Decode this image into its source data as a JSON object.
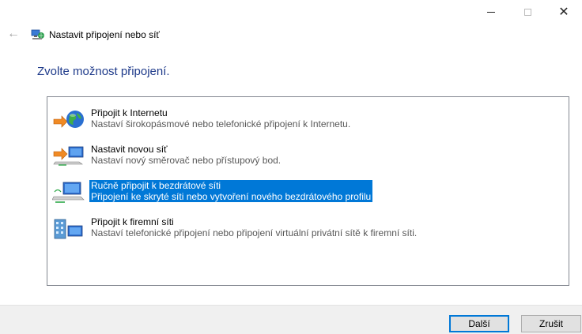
{
  "window": {
    "minimize_icon": "minimize-icon",
    "maximize_icon": "maximize-icon",
    "close_glyph": "✕"
  },
  "nav": {
    "back_glyph": "←",
    "title": "Nastavit připojení nebo síť"
  },
  "heading": "Zvolte možnost připojení.",
  "options": [
    {
      "title": "Připojit k Internetu",
      "description": "Nastaví širokopásmové nebo telefonické připojení k Internetu.",
      "icon": "globe-connection-icon",
      "selected": false
    },
    {
      "title": "Nastavit novou síť",
      "description": "Nastaví nový směrovač nebo přístupový bod.",
      "icon": "router-setup-icon",
      "selected": false
    },
    {
      "title": "Ručně připojit k bezdrátové síti",
      "description": "Připojení ke skryté síti nebo vytvoření nového bezdrátového profilu",
      "icon": "wireless-network-icon",
      "selected": true
    },
    {
      "title": "Připojit k firemní síti",
      "description": "Nastaví telefonické připojení nebo připojení virtuální privátní sítě k firemní síti.",
      "icon": "workplace-network-icon",
      "selected": false
    }
  ],
  "buttons": {
    "next": "Další",
    "cancel": "Zrušit"
  },
  "colors": {
    "accent": "#0078d7",
    "heading": "#1e3a8a"
  }
}
